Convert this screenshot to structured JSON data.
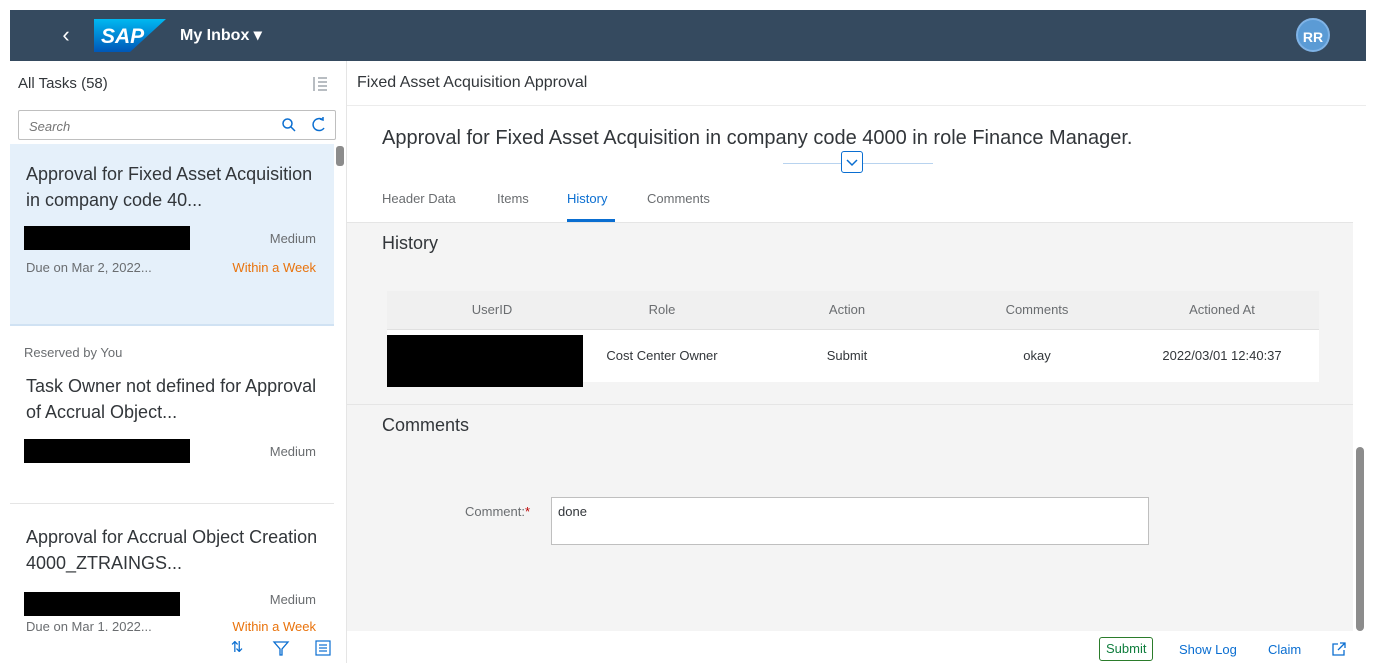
{
  "shell": {
    "back_icon": "back-chevron-icon",
    "logo_text": "SAP",
    "app_title": "My Inbox ▾",
    "avatar_initials": "RR",
    "brand_color": "#354a5f"
  },
  "master": {
    "header": "All Tasks (58)",
    "search_placeholder": "Search",
    "items": [
      {
        "title": "Approval for Fixed Asset Acquisition in company code 40...",
        "priority": "Medium",
        "due": "Due on Mar 2, 2022...",
        "deadline": "Within a Week",
        "selected": true
      },
      {
        "title": "Task Owner not defined for Approval of Accrual Object...",
        "priority": "Medium"
      },
      {
        "title": "Approval for Accrual Object Creation 4000_ZTRAINGS...",
        "priority": "Medium",
        "due": "Due on Mar 1, 2022...",
        "deadline": "Within a Week"
      }
    ],
    "group_header": "Reserved by You",
    "footer_icons": [
      "sort-icon",
      "filter-icon",
      "group-icon"
    ]
  },
  "detail": {
    "header": "Fixed Asset Acquisition Approval",
    "object_title": "Approval for Fixed Asset Acquisition in company code 4000 in role Finance Manager.",
    "tabs": [
      "Header Data",
      "Items",
      "History",
      "Comments"
    ],
    "active_tab": "History",
    "history": {
      "title": "History",
      "columns": [
        "UserID",
        "Role",
        "Action",
        "Comments",
        "Actioned At"
      ],
      "rows": [
        {
          "user_id": "",
          "role": "Cost Center Owner",
          "action": "Submit",
          "comments": "okay",
          "actioned_at": "2022/03/01 12:40:37"
        }
      ]
    },
    "comments": {
      "title": "Comments",
      "label": "Comment:",
      "required_mark": "*",
      "value": "done"
    },
    "footer": {
      "submit": "Submit",
      "show_log": "Show Log",
      "claim": "Claim"
    }
  }
}
